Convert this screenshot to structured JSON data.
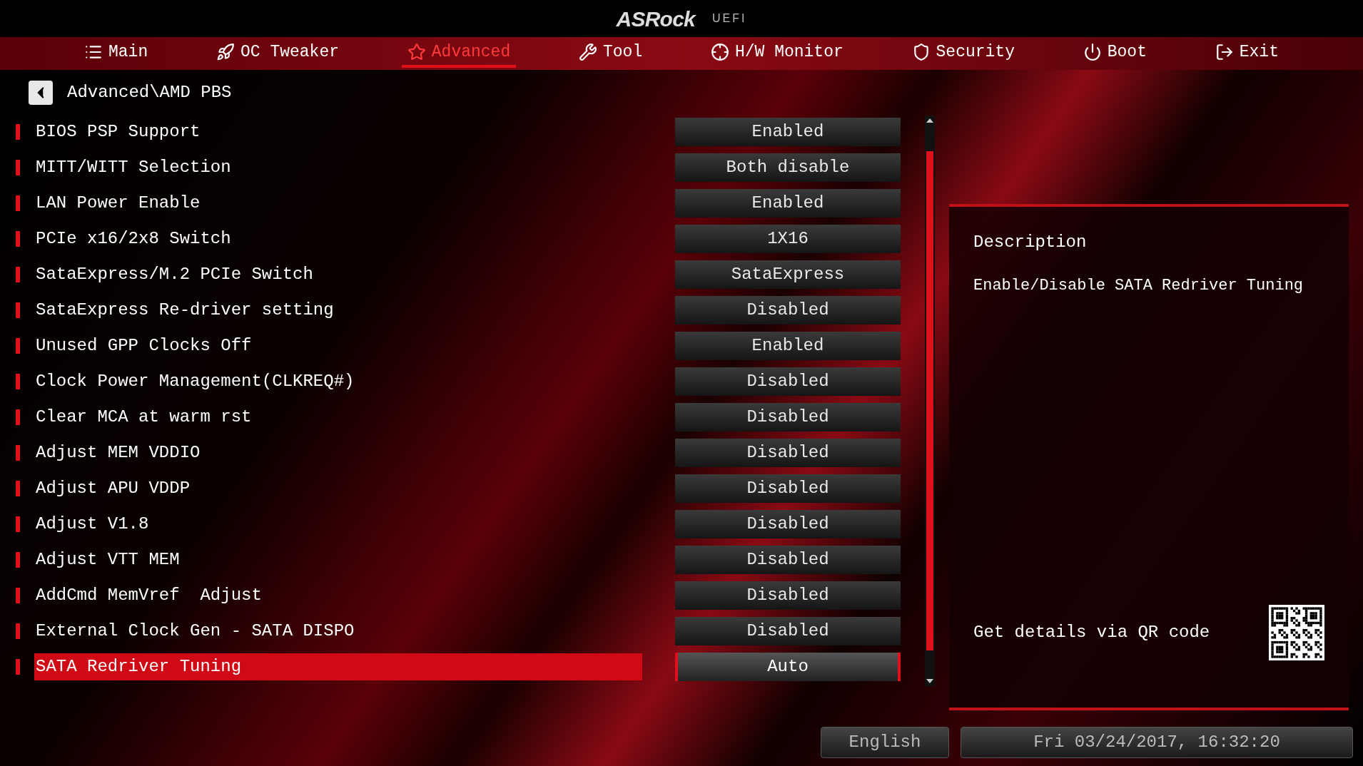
{
  "header": {
    "logo": "ASRock",
    "subtitle": "UEFI"
  },
  "tabs": [
    {
      "label": "Main",
      "kind": "list",
      "selected": false
    },
    {
      "label": "OC Tweaker",
      "kind": "rocket",
      "selected": false
    },
    {
      "label": "Advanced",
      "kind": "star",
      "selected": true
    },
    {
      "label": "Tool",
      "kind": "tool",
      "selected": false
    },
    {
      "label": "H/W Monitor",
      "kind": "monitor",
      "selected": false
    },
    {
      "label": "Security",
      "kind": "shield",
      "selected": false
    },
    {
      "label": "Boot",
      "kind": "power",
      "selected": false
    },
    {
      "label": "Exit",
      "kind": "exit",
      "selected": false
    }
  ],
  "breadcrumb": "Advanced\\AMD PBS",
  "settings": [
    {
      "label": "BIOS PSP Support",
      "value": "Enabled",
      "selected": false
    },
    {
      "label": "MITT/WITT Selection",
      "value": "Both disable",
      "selected": false
    },
    {
      "label": "LAN Power Enable",
      "value": "Enabled",
      "selected": false
    },
    {
      "label": "PCIe x16/2x8 Switch",
      "value": "1X16",
      "selected": false
    },
    {
      "label": "SataExpress/M.2 PCIe Switch",
      "value": "SataExpress",
      "selected": false
    },
    {
      "label": "SataExpress Re-driver setting",
      "value": "Disabled",
      "selected": false
    },
    {
      "label": "Unused GPP Clocks Off",
      "value": "Enabled",
      "selected": false
    },
    {
      "label": "Clock Power Management(CLKREQ#)",
      "value": "Disabled",
      "selected": false
    },
    {
      "label": "Clear MCA at warm rst",
      "value": "Disabled",
      "selected": false
    },
    {
      "label": "Adjust MEM VDDIO",
      "value": "Disabled",
      "selected": false
    },
    {
      "label": "Adjust APU VDDP",
      "value": "Disabled",
      "selected": false
    },
    {
      "label": "Adjust V1.8",
      "value": "Disabled",
      "selected": false
    },
    {
      "label": "Adjust VTT MEM",
      "value": "Disabled",
      "selected": false
    },
    {
      "label": "AddCmd MemVref  Adjust",
      "value": "Disabled",
      "selected": false
    },
    {
      "label": "External Clock Gen - SATA DISPO",
      "value": "Disabled",
      "selected": false
    },
    {
      "label": "SATA Redriver Tuning",
      "value": "Auto",
      "selected": true
    }
  ],
  "description": {
    "title": "Description",
    "text": "Enable/Disable SATA Redriver Tuning",
    "qr_label": "Get details via QR code"
  },
  "status_bar": {
    "language": "English",
    "datetime": "Fri 03/24/2017, 16:32:20"
  }
}
